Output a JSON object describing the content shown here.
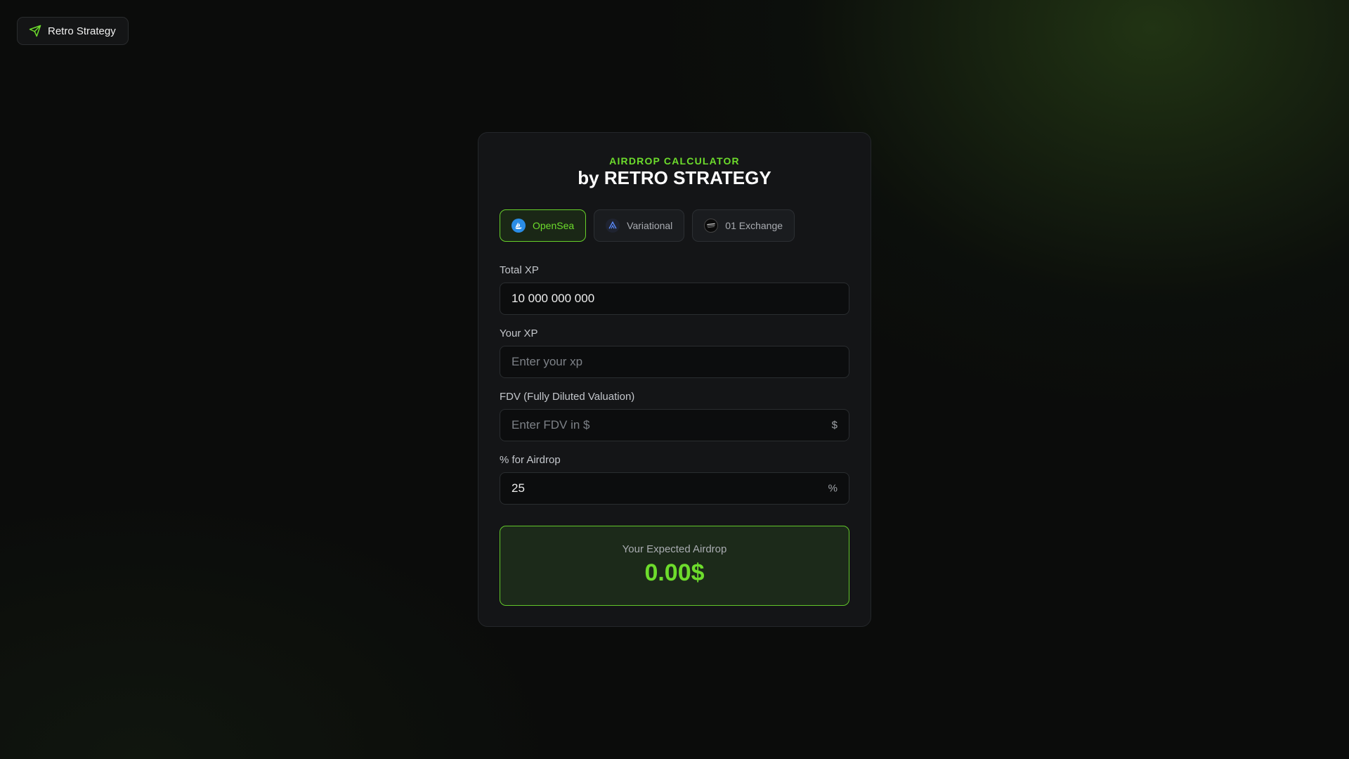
{
  "brand": {
    "label": "Retro Strategy",
    "icon": "send-icon"
  },
  "header": {
    "eyebrow": "AIRDROP CALCULATOR",
    "title": "by RETRO STRATEGY"
  },
  "tabs": [
    {
      "label": "OpenSea",
      "icon": "opensea-icon",
      "active": true
    },
    {
      "label": "Variational",
      "icon": "variational-icon",
      "active": false
    },
    {
      "label": "01 Exchange",
      "icon": "01-exchange-icon",
      "active": false
    }
  ],
  "fields": {
    "total_xp": {
      "label": "Total XP",
      "value": "10 000 000 000",
      "placeholder": ""
    },
    "your_xp": {
      "label": "Your XP",
      "value": "",
      "placeholder": "Enter your xp"
    },
    "fdv": {
      "label": "FDV (Fully Diluted Valuation)",
      "value": "",
      "placeholder": "Enter FDV in $",
      "suffix": "$"
    },
    "airdrop_pct": {
      "label": "% for Airdrop",
      "value": "25",
      "placeholder": "",
      "suffix": "%"
    }
  },
  "result": {
    "label": "Your Expected Airdrop",
    "value": "0.00$"
  },
  "colors": {
    "accent": "#6ddc2c",
    "background": "#0b0c0b",
    "card": "#141517"
  }
}
